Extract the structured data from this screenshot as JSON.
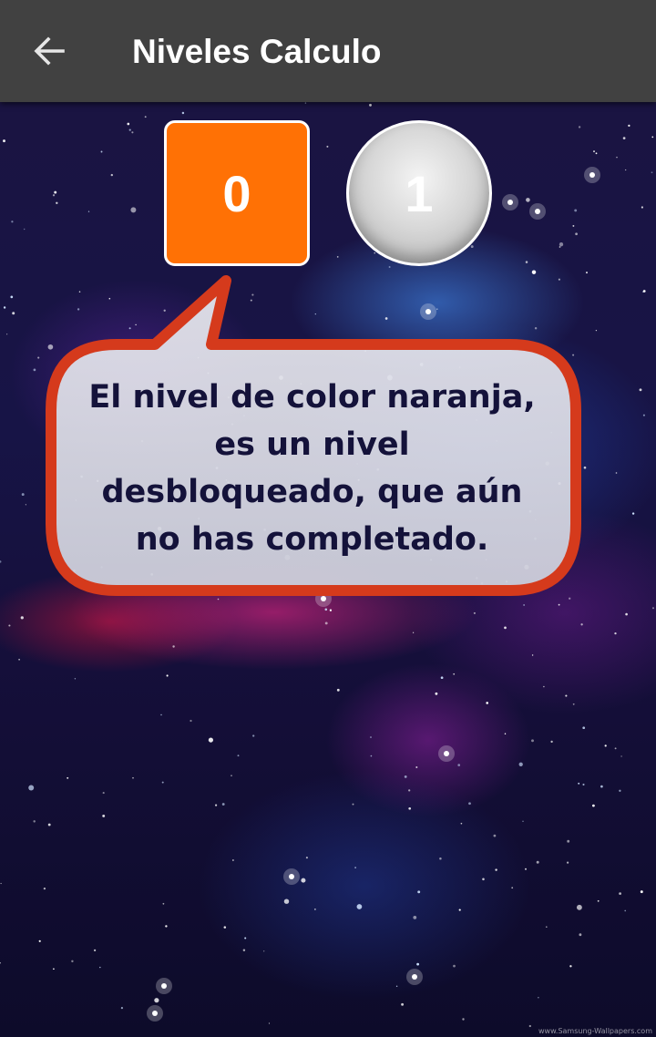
{
  "appbar": {
    "title": "Niveles Calculo",
    "back_icon": "arrow-left-icon",
    "background_color": "#414141"
  },
  "levels": [
    {
      "label": "0",
      "state": "unlocked-not-completed",
      "color": "#ff7105",
      "shape": "rounded-square"
    },
    {
      "label": "1",
      "state": "locked",
      "color": "#c8c8c8",
      "shape": "circle"
    }
  ],
  "tooltip": {
    "lines": [
      "El nivel de color naranja,",
      "es un nivel",
      "desbloqueado, que aún",
      "no has completado."
    ],
    "border_color": "#d53a1c",
    "fill_color": "#dcdde6"
  },
  "watermark": "www.Samsung-Wallpapers.com"
}
